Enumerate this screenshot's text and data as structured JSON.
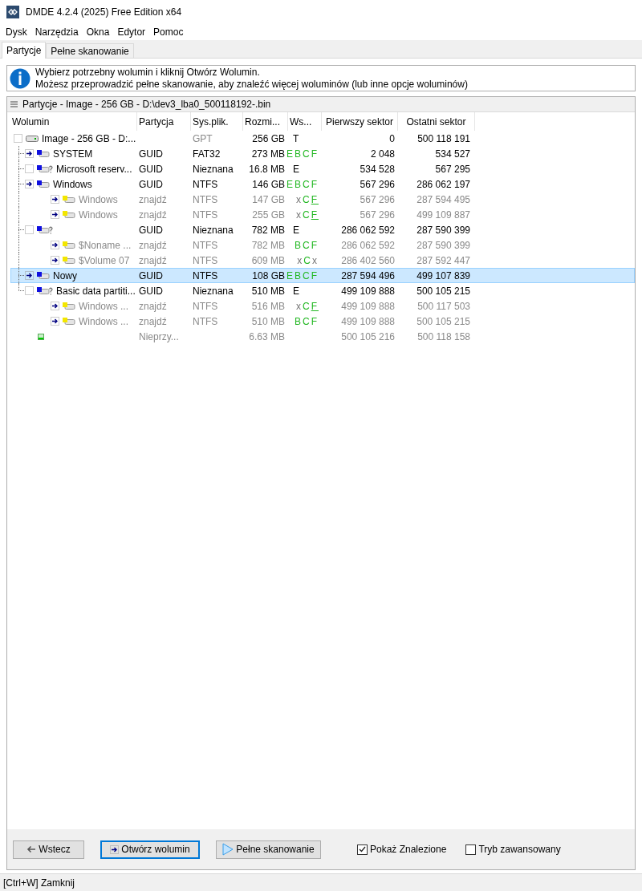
{
  "window": {
    "title": "DMDE 4.2.4 (2025) Free Edition x64"
  },
  "menu": [
    "Dysk",
    "Narzędzia",
    "Okna",
    "Edytor",
    "Pomoc"
  ],
  "tabs": [
    {
      "label": "Partycje",
      "selected": true
    },
    {
      "label": "Pełne skanowanie",
      "selected": false
    }
  ],
  "info": [
    "Wybierz potrzebny wolumin i kliknij Otwórz Wolumin.",
    "Możesz przeprowadzić pełne skanowanie, aby znaleźć więcej woluminów (lub inne opcje woluminów)"
  ],
  "panel_title": "Partycje - Image - 256 GB - D:\\dev3_lba0_500118192-.bin",
  "columns": [
    "Wolumin",
    "Partycja",
    "Sys.plik.",
    "Rozmi...",
    "Ws...",
    "Pierwszy sektor",
    "Ostatni sektor"
  ],
  "rows": [
    {
      "kind": "disk",
      "name": "Image - 256 GB - D:...",
      "fs": "GPT",
      "fs_dim": true,
      "size": "256 GB",
      "flags": [
        {
          "t": "T",
          "ok": false
        }
      ],
      "first": "0",
      "last": "500 118 191",
      "found": false,
      "selected": false,
      "openable": false,
      "children": [
        {
          "kind": "volume",
          "name": "SYSTEM",
          "partition": "GUID",
          "fs": "FAT32",
          "size": "273 MB",
          "flags": [
            {
              "t": "EBCF",
              "ok": true
            }
          ],
          "first": "2 048",
          "last": "534 527",
          "found": false,
          "selected": false,
          "openable": true,
          "unknown": false
        },
        {
          "kind": "volume",
          "name": "Microsoft reserv...",
          "partition": "GUID",
          "fs": "Nieznana",
          "size": "16.8 MB",
          "flags": [
            {
              "t": "E",
              "ok": false
            }
          ],
          "first": "534 528",
          "last": "567 295",
          "found": false,
          "selected": false,
          "openable": false,
          "unknown": true
        },
        {
          "kind": "volume",
          "name": "Windows",
          "partition": "GUID",
          "fs": "NTFS",
          "size": "146 GB",
          "flags": [
            {
              "t": "EBCF",
              "ok": true
            }
          ],
          "first": "567 296",
          "last": "286 062 197",
          "found": false,
          "selected": false,
          "openable": true,
          "unknown": false,
          "children": [
            {
              "kind": "volume",
              "name": "Windows",
              "partition": "znajdź",
              "fs": "NTFS",
              "size": "147 GB",
              "flags": [
                {
                  "t": "x",
                  "ok": false
                },
                {
                  "t": "C",
                  "ok": true
                },
                {
                  "t": "F",
                  "ok": true,
                  "underline": true
                }
              ],
              "first": "567 296",
              "last": "287 594 495",
              "found": true,
              "selected": false,
              "openable": true,
              "unknown": false
            },
            {
              "kind": "volume",
              "name": "Windows",
              "partition": "znajdź",
              "fs": "NTFS",
              "size": "255 GB",
              "flags": [
                {
                  "t": "x",
                  "ok": false
                },
                {
                  "t": "C",
                  "ok": true
                },
                {
                  "t": "F",
                  "ok": true,
                  "underline": true
                }
              ],
              "first": "567 296",
              "last": "499 109 887",
              "found": true,
              "selected": false,
              "openable": true,
              "unknown": false
            }
          ]
        },
        {
          "kind": "volume",
          "partition": "GUID",
          "fs": "Nieznana",
          "size": "782 MB",
          "flags": [
            {
              "t": "E",
              "ok": false
            }
          ],
          "first": "286 062 592",
          "last": "287 590 399",
          "found": false,
          "selected": false,
          "openable": false,
          "unknown": true,
          "children": [
            {
              "kind": "volume",
              "name": "$Noname ...",
              "partition": "znajdź",
              "fs": "NTFS",
              "size": "782 MB",
              "flags": [
                {
                  "t": "BCF",
                  "ok": true
                }
              ],
              "first": "286 062 592",
              "last": "287 590 399",
              "found": true,
              "selected": false,
              "openable": true,
              "unknown": false
            },
            {
              "kind": "volume",
              "name": "$Volume 07",
              "partition": "znajdź",
              "fs": "NTFS",
              "size": "609 MB",
              "flags": [
                {
                  "t": "x",
                  "ok": false
                },
                {
                  "t": "C",
                  "ok": true
                },
                {
                  "t": "x",
                  "ok": false
                }
              ],
              "first": "286 402 560",
              "last": "287 592 447",
              "found": true,
              "selected": false,
              "openable": true,
              "unknown": false
            }
          ]
        },
        {
          "kind": "volume",
          "name": "Nowy",
          "partition": "GUID",
          "fs": "NTFS",
          "size": "108 GB",
          "flags": [
            {
              "t": "EBCF",
              "ok": true
            }
          ],
          "first": "287 594 496",
          "last": "499 107 839",
          "found": false,
          "selected": true,
          "openable": true,
          "unknown": false
        },
        {
          "kind": "volume",
          "name": "Basic data partiti...",
          "partition": "GUID",
          "fs": "Nieznana",
          "size": "510 MB",
          "flags": [
            {
              "t": "E",
              "ok": false
            }
          ],
          "first": "499 109 888",
          "last": "500 105 215",
          "found": false,
          "selected": false,
          "openable": false,
          "unknown": true,
          "children": [
            {
              "kind": "volume",
              "name": "Windows ...",
              "partition": "znajdź",
              "fs": "NTFS",
              "size": "516 MB",
              "flags": [
                {
                  "t": "x",
                  "ok": false
                },
                {
                  "t": "C",
                  "ok": true
                },
                {
                  "t": "F",
                  "ok": true,
                  "underline": true
                }
              ],
              "first": "499 109 888",
              "last": "500 117 503",
              "found": true,
              "selected": false,
              "openable": true,
              "unknown": false
            },
            {
              "kind": "volume",
              "name": "Windows ...",
              "partition": "znajdź",
              "fs": "NTFS",
              "size": "510 MB",
              "flags": [
                {
                  "t": "BCF",
                  "ok": true
                }
              ],
              "first": "499 109 888",
              "last": "500 105 215",
              "found": true,
              "selected": false,
              "openable": true,
              "unknown": false
            }
          ]
        },
        {
          "kind": "free",
          "partition": "Nieprzy...",
          "size": "6.63 MB",
          "first": "500 105 216",
          "last": "500 118 158",
          "found": true,
          "selected": false
        }
      ]
    }
  ],
  "buttons": [
    {
      "kind": "back",
      "label": "Wstecz",
      "focused": false
    },
    {
      "kind": "open",
      "label": "Otwórz wolumin",
      "focused": true
    },
    {
      "kind": "scan",
      "label": "Pełne skanowanie",
      "focused": false
    }
  ],
  "options": [
    {
      "label": "Pokaż Znalezione",
      "checked": true
    },
    {
      "label": "Tryb zawansowany",
      "checked": false
    }
  ],
  "status_bar": "[Ctrl+W] Zamknij"
}
